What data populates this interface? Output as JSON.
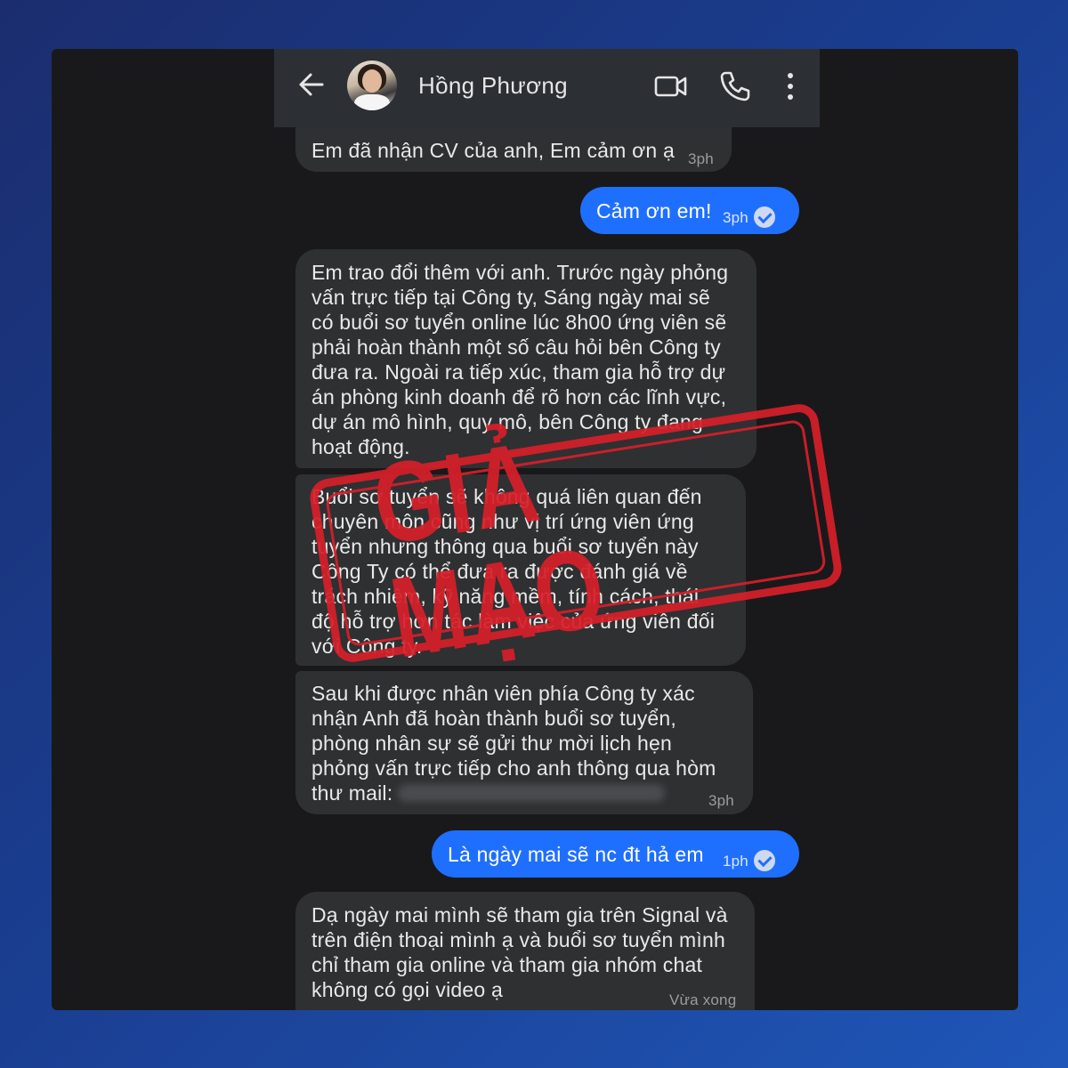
{
  "header": {
    "contact_name": "Hồng Phương",
    "icons": [
      "back-arrow-icon",
      "avatar",
      "video-call-icon",
      "phone-icon",
      "more-vertical-icon"
    ]
  },
  "messages": [
    {
      "direction": "incoming",
      "text": "Em đã nhận CV của anh, Em cảm ơn ạ",
      "time": "3ph"
    },
    {
      "direction": "outgoing",
      "text": "Cảm ơn em!",
      "time": "3ph",
      "status": "seen"
    },
    {
      "direction": "incoming",
      "lines": [
        "Em trao đổi thêm với anh. Trước ngày phỏng",
        "vấn trực tiếp tại Công ty, Sáng ngày mai sẽ",
        "có buổi sơ tuyển online lúc 8h00 ứng viên sẽ",
        "phải hoàn thành một số câu hỏi bên Công ty",
        "đưa ra. Ngoài ra tiếp xúc, tham gia hỗ trợ dự",
        "án phòng kinh doanh để rõ hơn các lĩnh vực,",
        "dự án mô hình, quy mô, bên Công ty đang",
        "hoạt động."
      ]
    },
    {
      "direction": "incoming",
      "lines": [
        "Buổi sơ tuyển sẽ không quá liên quan đến",
        "chuyên môn cũng như vị trí ứng viên ứng",
        "tuyển nhưng thông qua buổi sơ tuyển này",
        "Công Ty có thể đưa ra được đánh giá về",
        "trách nhiệm, kỹ năng mềm, tính cách, thái",
        "độ hỗ trợ hơn tác làm việc của ứng viên đối",
        "với Công ty."
      ]
    },
    {
      "direction": "incoming",
      "lines": [
        "Sau khi được nhân viên phía Công ty xác",
        "nhận Anh đã hoàn thành buổi sơ tuyển,",
        "phòng nhân sự sẽ gửi thư mời lịch hẹn",
        "phỏng vấn trực tiếp cho anh thông qua hòm",
        "thư mail:"
      ],
      "time": "3ph"
    },
    {
      "direction": "outgoing",
      "text": "Là ngày mai sẽ nc đt hả em",
      "time": "1ph",
      "status": "seen"
    },
    {
      "direction": "incoming",
      "lines": [
        "Dạ ngày mai mình sẽ tham gia trên Signal và",
        "trên điện thoại mình ạ và buổi sơ tuyển mình",
        "chỉ tham gia online và tham gia nhóm chat",
        "không có gọi video ạ"
      ],
      "time": "Vừa xong"
    }
  ],
  "stamp": {
    "text": "GIẢ MẠO",
    "color": "#d51f2a"
  },
  "colors": {
    "outgoing_bubble": "#1f6fff",
    "incoming_bubble": "#2f3032",
    "background": "#19191b"
  }
}
